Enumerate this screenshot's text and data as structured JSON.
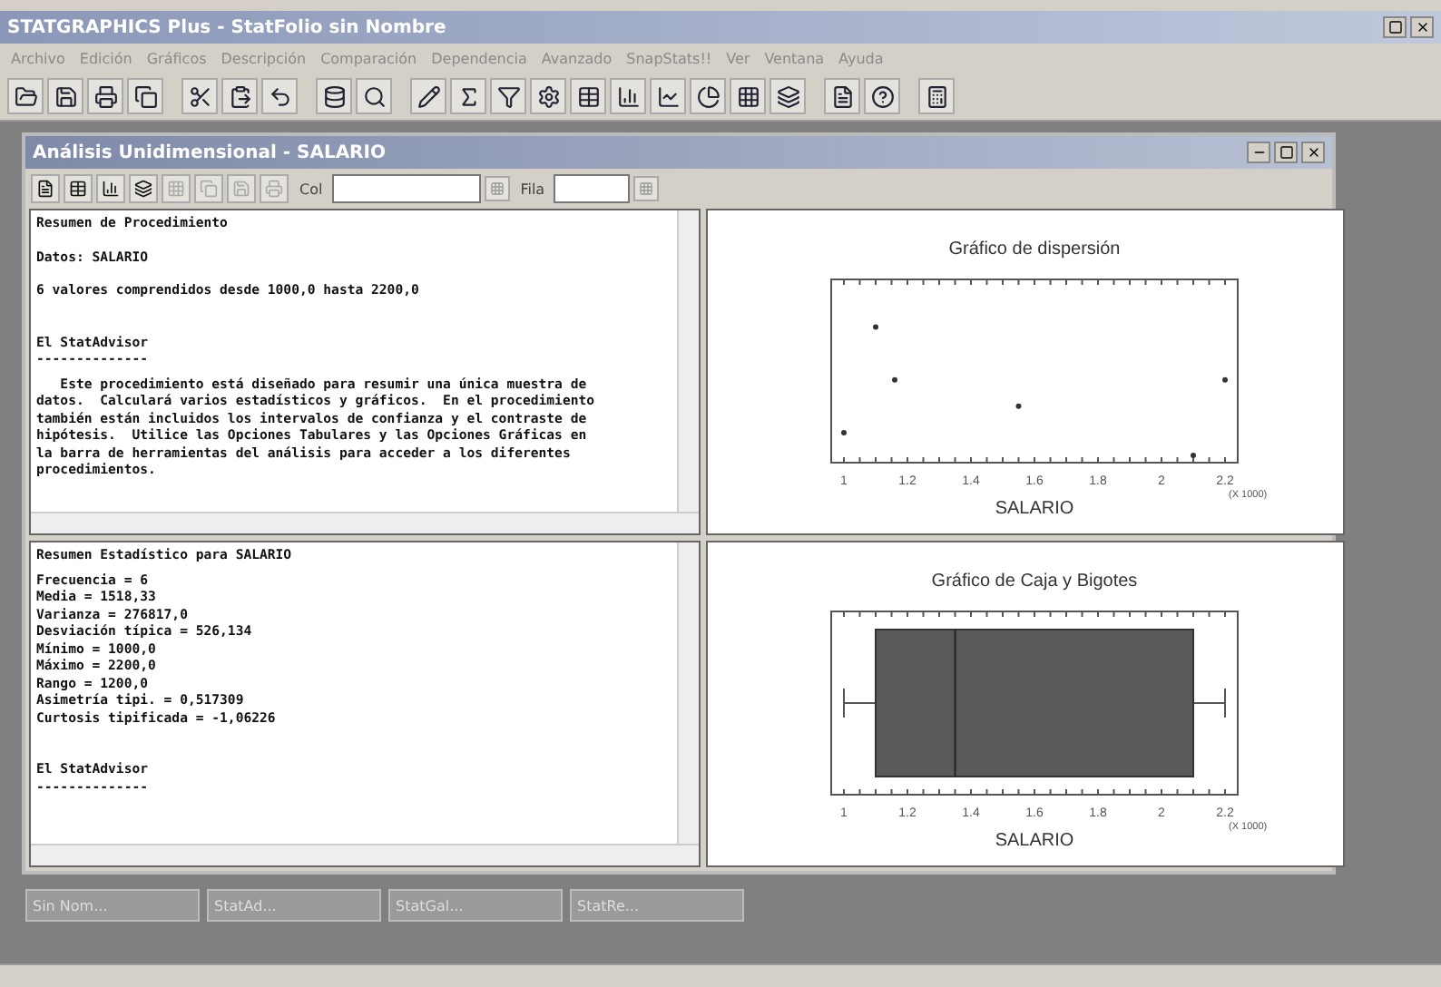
{
  "app": {
    "title": "STATGRAPHICS Plus - StatFolio sin Nombre"
  },
  "menu": [
    {
      "label": "Archivo"
    },
    {
      "label": "Edición"
    },
    {
      "label": "Gráficos"
    },
    {
      "label": "Descripción"
    },
    {
      "label": "Comparación"
    },
    {
      "label": "Dependencia"
    },
    {
      "label": "Avanzado"
    },
    {
      "label": "SnapStats!!"
    },
    {
      "label": "Ver"
    },
    {
      "label": "Ventana"
    },
    {
      "label": "Ayuda"
    }
  ],
  "child": {
    "title": "Análisis Unidimensional - SALARIO",
    "col_label": "Col",
    "row_label": "Fila"
  },
  "panes": [
    {
      "blocks": [
        {
          "kind": "heading",
          "text": "Resumen de Procedimiento"
        },
        {
          "kind": "body",
          "text": "Datos: SALARIO"
        },
        {
          "kind": "body",
          "text": "6 valores comprendidos desde 1000,0 hasta 2200,0"
        },
        {
          "kind": "advisor",
          "text": "El StatAdvisor\n--------------"
        },
        {
          "kind": "paragraph",
          "text": "   Este procedimiento está diseñado para resumir una única muestra de\ndatos.  Calculará varios estadísticos y gráficos.  En el procedimiento\ntambién están incluidos los intervalos de confianza y el contraste de\nhipótesis.  Utilice las Opciones Tabulares y las Opciones Gráficas en\nla barra de herramientas del análisis para acceder a los diferentes\nprocedimientos."
        }
      ]
    },
    {
      "blocks": [
        {
          "kind": "heading",
          "text": "Resumen Estadístico para SALARIO"
        },
        {
          "kind": "paragraph",
          "text": "Frecuencia = 6\nMedia = 1518,33\nVarianza = 276817,0\nDesviación típica = 526,134\nMínimo = 1000,0\nMáximo = 2200,0\nRango = 1200,0\nAsimetría tipi. = 0,517309\nCurtosis tipificada = -1,06226"
        },
        {
          "kind": "advisor",
          "text": "El StatAdvisor\n--------------"
        }
      ]
    }
  ],
  "charts": [
    {
      "kind": "scatter",
      "title": "Gráfico de dispersión",
      "xlabel": "SALARIO",
      "tick_labels": [
        "1",
        "1.2",
        "1.4",
        "1.6",
        "1.8",
        "2",
        "2.2"
      ],
      "scale_note": "(X 1000)"
    },
    {
      "kind": "box",
      "title": "Gráfico de Caja y Bigotes",
      "xlabel": "SALARIO",
      "tick_labels": [
        "1",
        "1.2",
        "1.4",
        "1.6",
        "1.8",
        "2",
        "2.2"
      ],
      "scale_note": "(X 1000)"
    }
  ],
  "minimized": [
    {
      "label": "Sin Nom..."
    },
    {
      "label": "StatAd..."
    },
    {
      "label": "StatGal..."
    },
    {
      "label": "StatRe..."
    }
  ]
}
